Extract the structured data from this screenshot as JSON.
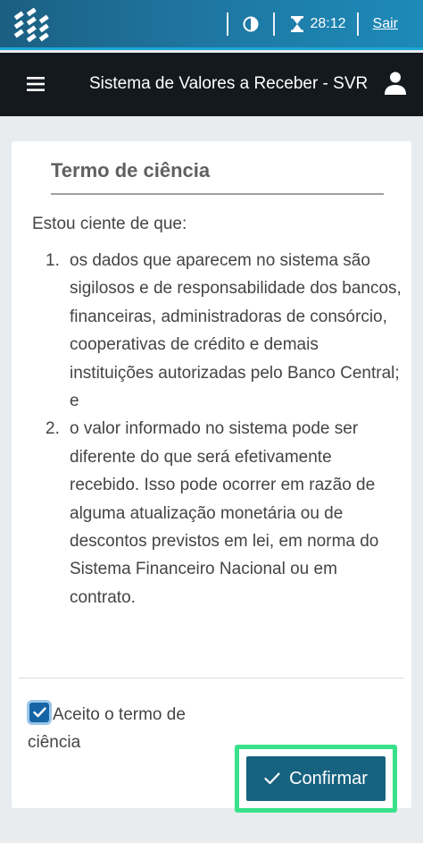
{
  "gov_bar": {
    "timer": "28:12",
    "logout_label": "Sair"
  },
  "header": {
    "title": "Sistema de Valores a Receber - SVR"
  },
  "card": {
    "title": "Termo de ciência",
    "intro": "Estou ciente de que:",
    "items": [
      {
        "number": "1.",
        "text": "os dados que aparecem no sistema são sigilosos e de responsabilidade dos bancos, financeiras, administradoras de consórcio, cooperativas de crédito e demais instituições autorizadas pelo Banco Central; e"
      },
      {
        "number": "2.",
        "text": "o valor informado no sistema pode ser diferente do que será efetivamente recebido. Isso pode ocorrer em razão de alguma atualização monetária ou de descontos previstos em lei, em norma do Sistema Financeiro Nacional ou em contrato."
      }
    ],
    "accept_label": "Aceito o termo de ciência",
    "accept_checked": true,
    "confirm_label": "Confirmar"
  },
  "colors": {
    "gov_bar": "#1f75a0",
    "app_bar": "#14191e",
    "confirm_button": "#17627f",
    "focus_outline": "#38e28a",
    "checkbox": "#1565a6"
  },
  "icons": {
    "logo": "bcb-logo-icon",
    "contrast": "contrast-icon",
    "timer": "hourglass-icon",
    "menu": "hamburger-menu-icon",
    "user": "user-icon",
    "check": "checkmark-icon"
  }
}
